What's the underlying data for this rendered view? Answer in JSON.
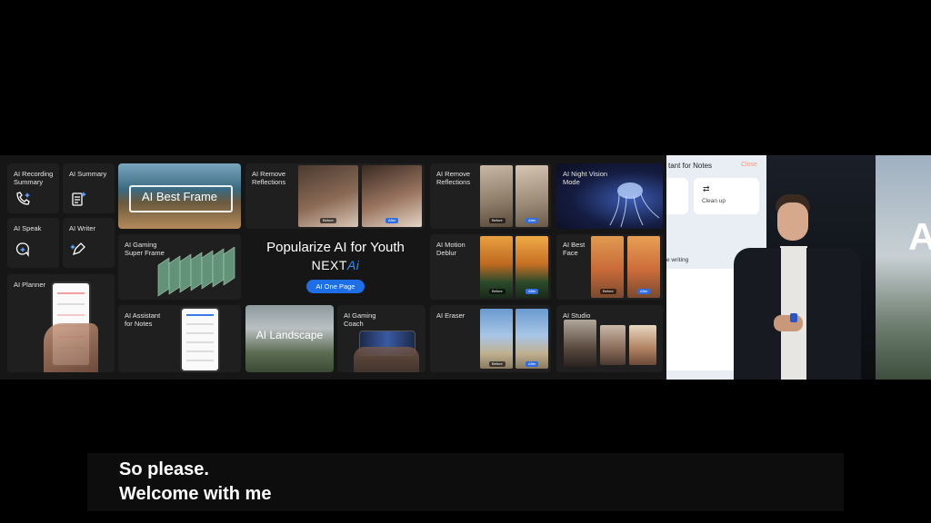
{
  "slide": {
    "tiles": {
      "recording": "AI Recording\nSummary",
      "summary": "AI Summary",
      "speak": "AI Speak",
      "writer": "AI Writer",
      "planner": "AI Planner",
      "best_frame": "AI Best Frame",
      "gaming_super": "AI Gaming\nSuper Frame",
      "assistant_notes": "AI Assistant\nfor Notes",
      "landscape": "AI Landscape",
      "remove_refl_1": "AI Remove\nReflections",
      "remove_refl_2": "AI Remove\nReflections",
      "gaming_coach": "AI Gaming\nCoach",
      "motion_deblur": "AI Motion\nDeblur",
      "eraser": "AI Eraser",
      "night_vision": "AI Night Vision\nMode",
      "best_face": "AI Best\nFace",
      "studio": "AI Studio"
    },
    "center": {
      "headline": "Popularize AI for Youth",
      "brand_prefix": "NEXT",
      "brand_suffix": "Ai",
      "button": "AI One Page"
    },
    "pills": {
      "before": "Before",
      "after": "After"
    }
  },
  "video": {
    "app_title": "tant for Notes",
    "close": "Close",
    "cleanup": "Clean up",
    "writing": "e writing",
    "big_letter": "A"
  },
  "subtitles": {
    "line1": "So please.",
    "line2": "Welcome with me"
  },
  "colors": {
    "accent_blue": "#2f6de0",
    "tile_bg": "#1f1f1f",
    "stage_bg": "#161616"
  }
}
